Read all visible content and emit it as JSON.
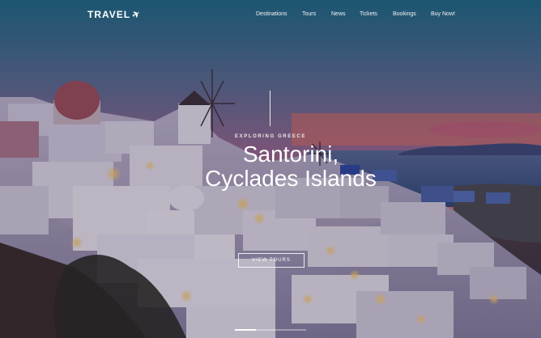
{
  "brand": {
    "logo_text": "TRAVEL",
    "logo_icon": "airplane-icon"
  },
  "nav": {
    "items": [
      {
        "label": "Destinations"
      },
      {
        "label": "Tours"
      },
      {
        "label": "News"
      },
      {
        "label": "Tickets"
      },
      {
        "label": "Bookings"
      },
      {
        "label": "Buy Now!"
      }
    ]
  },
  "hero": {
    "kicker": "EXPLORING GREECE",
    "title_line1": "Santorini,",
    "title_line2": "Cyclades Islands",
    "cta_label": "VIEW TOURS",
    "slider_progress": 0.3
  },
  "colors": {
    "sky_top": "#1f6f86",
    "sky_mid": "#8a5b86",
    "sunset": "#e06a6c",
    "sea": "#3a5a88",
    "text": "#ffffff"
  }
}
